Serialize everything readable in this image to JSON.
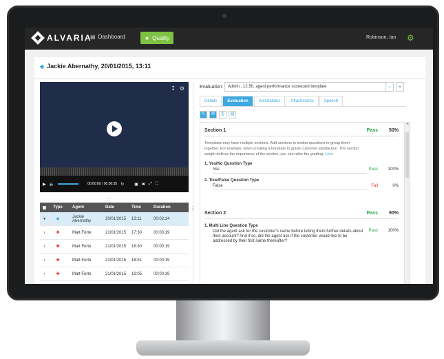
{
  "app": {
    "logo_text": "ALVARIA",
    "nav_dashboard": "Dashboard",
    "nav_quality": "Quality",
    "user_name": "Robinson, Ian"
  },
  "record": {
    "title": "Jackie Abernathy, 20/01/2015, 13:11"
  },
  "player": {
    "timecode": "00:00:00 / 00:00:35"
  },
  "table": {
    "headers": [
      "Type",
      "Agent",
      "Date",
      "Time",
      "Duration"
    ],
    "rows": [
      {
        "agent": "Jackie Abernathy",
        "date": "20/01/2015",
        "time": "13:11",
        "duration": "00:02:14"
      },
      {
        "agent": "Matt Forte",
        "date": "21/01/2015",
        "time": "17:30",
        "duration": "00:00:19"
      },
      {
        "agent": "Matt Forte",
        "date": "21/01/2015",
        "time": "18:30",
        "duration": "00:00:19"
      },
      {
        "agent": "Matt Forte",
        "date": "21/01/2015",
        "time": "18:51",
        "duration": "00:00:19"
      },
      {
        "agent": "Matt Forte",
        "date": "21/01/2015",
        "time": "19:05",
        "duration": "00:00:19"
      }
    ]
  },
  "evaluation": {
    "label": "Evaluation:",
    "selected": "Admin , 12.50, agent performance scorecard template",
    "tabs": [
      "Details",
      "Evaluation",
      "Annotations",
      "Attachments",
      "Speech"
    ],
    "active_tab": "Evaluation"
  },
  "sections": [
    {
      "title": "Section 1",
      "result": "Pass",
      "score": "50%",
      "description": "Templates may have multiple sections. Add sections to similar questions to group them together. For example, when creating a template to grade customer satisfaction. The section weight defines the importance of the section; you can tailor the grading.",
      "less_link": "Less",
      "questions": [
        {
          "title": "1.  Yes/No Question Type",
          "answer": "Yes",
          "result": "Pass",
          "score": "100%"
        },
        {
          "title": "2.  True/False Question Type",
          "answer": "False",
          "result": "Fail",
          "score": "0%"
        }
      ]
    },
    {
      "title": "Section 2",
      "result": "Pass",
      "score": "90%",
      "questions": [
        {
          "title": "1.  Multi Line Question Type",
          "answer": "Did the agent ask for the customer's name before telling them further details about their account? And if so, did the agent ask if the customer would like to be addressed by their first name thereafter?",
          "result": "Pass",
          "score": "100%"
        }
      ]
    }
  ],
  "colors": {
    "topbar": "#262626",
    "accent_green": "#7dc242",
    "accent_blue": "#3da9e0",
    "player_bg": "#1f2d4a",
    "pass": "#27a745",
    "fail": "#e03232"
  }
}
